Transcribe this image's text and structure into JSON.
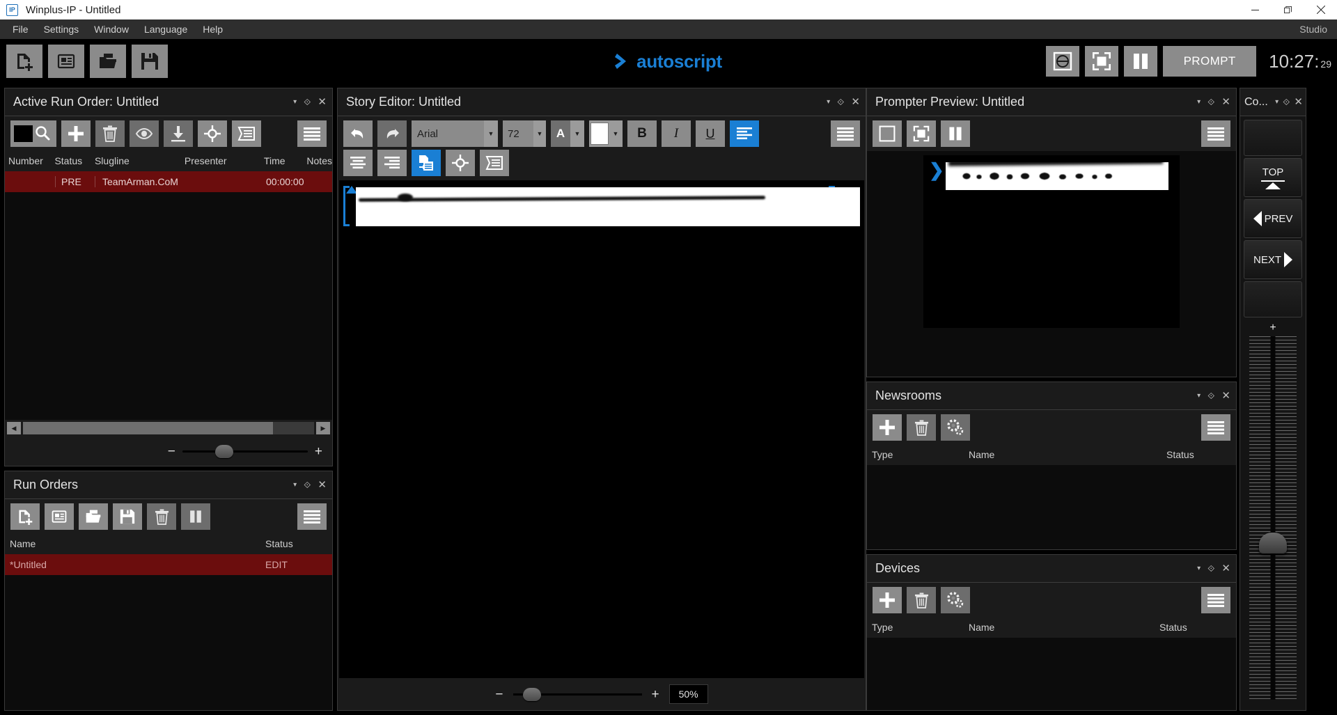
{
  "titlebar": {
    "app_name": "Winplus-IP - Untitled",
    "logo_text": "IP",
    "minimize": "—",
    "maximize": "❐",
    "close": "✕"
  },
  "menubar": {
    "items": [
      "File",
      "Settings",
      "Window",
      "Language",
      "Help"
    ],
    "mode_label": "Studio"
  },
  "app_toolbar": {
    "left_buttons": [
      {
        "name": "new-run-order-button",
        "icon": "page-plus-icon"
      },
      {
        "name": "new-story-button",
        "icon": "news-page-icon"
      },
      {
        "name": "open-button",
        "icon": "folder-open-icon"
      },
      {
        "name": "save-button",
        "icon": "floppy-save-icon"
      }
    ],
    "brand": "autoscript",
    "brand_color": "#1a7fd4",
    "right_buttons": [
      {
        "name": "prompter-output-button",
        "icon": "circle-split-icon"
      },
      {
        "name": "fullscreen-button",
        "icon": "fullscreen-icon"
      },
      {
        "name": "pause-button",
        "icon": "pause-icon"
      }
    ],
    "prompt_label": "PROMPT",
    "clock_hm": "10:27:",
    "clock_ss": "29"
  },
  "active_run_order": {
    "title": "Active Run Order: Untitled",
    "toolbar": [
      {
        "name": "color-search-button",
        "icon": "swatch-search-icon"
      },
      {
        "name": "add-story-button",
        "icon": "plus-icon"
      },
      {
        "name": "delete-story-button",
        "icon": "trash-icon"
      },
      {
        "name": "preview-button",
        "icon": "eye-icon"
      },
      {
        "name": "download-button",
        "icon": "download-icon"
      },
      {
        "name": "target-button",
        "icon": "target-icon"
      },
      {
        "name": "script-button",
        "icon": "script-icon"
      },
      {
        "name": "menu-button",
        "icon": "hamburger-icon"
      }
    ],
    "columns": [
      "Number",
      "Status",
      "Slugline",
      "Presenter",
      "Time",
      "Notes"
    ],
    "rows": [
      {
        "number": "",
        "status": "PRE",
        "slugline": "TeamArman.CoM",
        "presenter": "",
        "time": "00:00:00",
        "notes": ""
      }
    ],
    "zoom_minus": "−",
    "zoom_plus": "+"
  },
  "run_orders": {
    "title": "Run Orders",
    "toolbar": [
      {
        "name": "new-run-order-button",
        "icon": "page-plus-icon"
      },
      {
        "name": "new-story-button",
        "icon": "news-page-icon"
      },
      {
        "name": "open-run-order-button",
        "icon": "folder-open-icon"
      },
      {
        "name": "save-run-order-button",
        "icon": "floppy-save-icon"
      },
      {
        "name": "delete-run-order-button",
        "icon": "trash-icon"
      },
      {
        "name": "pause-run-order-button",
        "icon": "pause-icon"
      },
      {
        "name": "menu-button",
        "icon": "hamburger-icon"
      }
    ],
    "columns": [
      "Name",
      "Status"
    ],
    "rows": [
      {
        "name": "*Untitled",
        "status": "EDIT"
      }
    ]
  },
  "story_editor": {
    "title": "Story Editor: Untitled",
    "toolbar_row1": [
      {
        "name": "undo-button",
        "icon": "undo-icon"
      },
      {
        "name": "redo-button",
        "icon": "redo-icon"
      }
    ],
    "font_family": "Arial",
    "font_size": "72",
    "font_color_label": "A",
    "highlight_color": "#ffffff",
    "format_buttons": [
      {
        "name": "bold-button",
        "label": "B"
      },
      {
        "name": "italic-button",
        "label": "I"
      },
      {
        "name": "underline-button",
        "label": "U"
      }
    ],
    "align_buttons": [
      {
        "name": "align-left-button",
        "icon": "align-left-icon",
        "active": true
      },
      {
        "name": "paragraph-menu-button",
        "icon": "hamburger-icon",
        "active": false
      }
    ],
    "toolbar_row2": [
      {
        "name": "align-center-button",
        "icon": "align-center-icon",
        "active": false
      },
      {
        "name": "align-right-button",
        "icon": "align-right-icon",
        "active": false
      },
      {
        "name": "insert-story-button",
        "icon": "insert-page-icon",
        "active": true
      },
      {
        "name": "target-button",
        "icon": "target-icon",
        "active": false
      },
      {
        "name": "script-button",
        "icon": "script-icon",
        "active": false
      }
    ],
    "zoom_minus": "−",
    "zoom_plus": "+",
    "zoom_level": "50%"
  },
  "prompter_preview": {
    "title": "Prompter Preview: Untitled",
    "toolbar": [
      {
        "name": "prompter-output-button",
        "icon": "circle-split-icon"
      },
      {
        "name": "fullscreen-button",
        "icon": "fullscreen-icon"
      },
      {
        "name": "pause-button",
        "icon": "pause-icon"
      },
      {
        "name": "menu-button",
        "icon": "hamburger-icon"
      }
    ],
    "cue_marker": "❯"
  },
  "newsrooms": {
    "title": "Newsrooms",
    "toolbar": [
      {
        "name": "add-newsroom-button",
        "icon": "plus-icon"
      },
      {
        "name": "delete-newsroom-button",
        "icon": "trash-icon"
      },
      {
        "name": "newsroom-settings-button",
        "icon": "gears-icon"
      },
      {
        "name": "menu-button",
        "icon": "hamburger-icon"
      }
    ],
    "columns": [
      "Type",
      "Name",
      "Status"
    ],
    "rows": []
  },
  "devices": {
    "title": "Devices",
    "toolbar": [
      {
        "name": "add-device-button",
        "icon": "plus-icon"
      },
      {
        "name": "delete-device-button",
        "icon": "trash-icon"
      },
      {
        "name": "device-settings-button",
        "icon": "gears-icon"
      },
      {
        "name": "menu-button",
        "icon": "hamburger-icon"
      }
    ],
    "columns": [
      "Type",
      "Name",
      "Status"
    ],
    "rows": []
  },
  "control_panel": {
    "title": "Co...",
    "top_label": "TOP",
    "prev_label": "PREV",
    "next_label": "NEXT",
    "fader_plus": "+"
  },
  "panel_controls": {
    "caret": "▾",
    "pin": "⟐",
    "close": "✕"
  }
}
